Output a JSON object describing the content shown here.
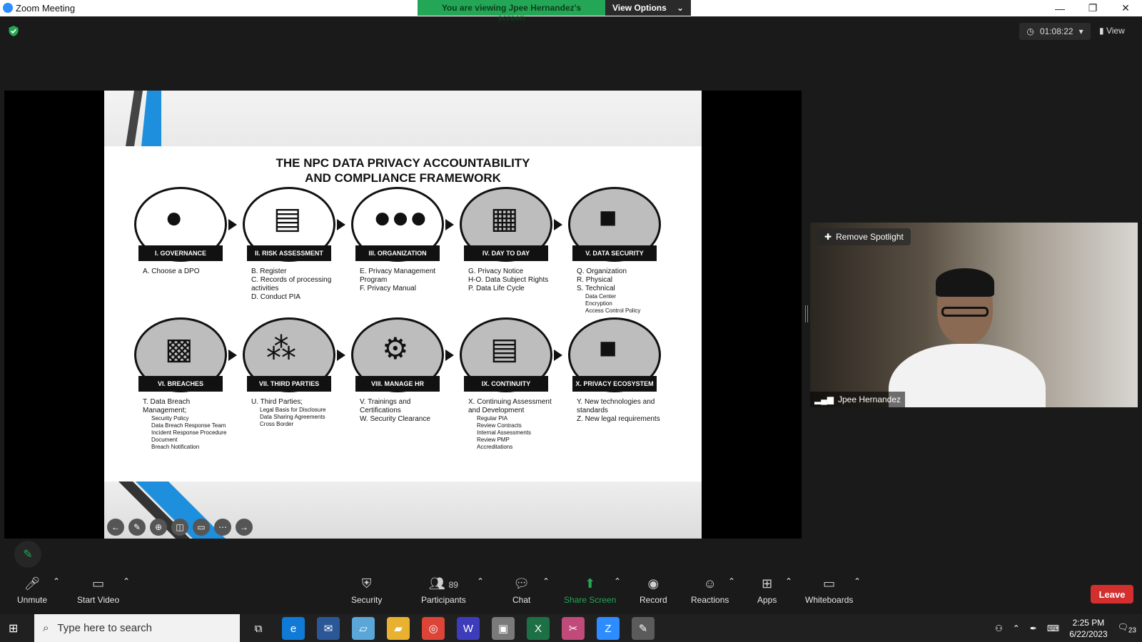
{
  "window": {
    "title": "Zoom Meeting",
    "minimize": "—",
    "restore": "❐",
    "close": "✕"
  },
  "banner": {
    "message": "You are viewing Jpee Hernandez's screen",
    "options_label": "View Options",
    "options_caret": "⌄"
  },
  "meeting": {
    "timer": "01:08:22",
    "timer_caret": "▾",
    "view_label": "View"
  },
  "slide": {
    "title_line1": "THE NPC DATA PRIVACY ACCOUNTABILITY",
    "title_line2": "AND COMPLIANCE FRAMEWORK",
    "stages": [
      {
        "banner": "I. GOVERNANCE",
        "items": [
          "A. Choose a DPO"
        ],
        "subitems": []
      },
      {
        "banner": "II. RISK ASSESSMENT",
        "items": [
          "B. Register",
          "C. Records of processing activities",
          "D. Conduct PIA"
        ],
        "subitems": []
      },
      {
        "banner": "III. ORGANIZATION",
        "items": [
          "E. Privacy Management Program",
          "F. Privacy Manual"
        ],
        "subitems": []
      },
      {
        "banner": "IV. DAY TO DAY",
        "items": [
          "G. Privacy Notice",
          "H-O. Data Subject Rights",
          "P. Data Life Cycle"
        ],
        "subitems": []
      },
      {
        "banner": "V. DATA SECURITY",
        "items": [
          "Q. Organization",
          "R. Physical",
          "S. Technical"
        ],
        "subitems": [
          "Data Center",
          "Encryption",
          "Access Control Policy"
        ]
      },
      {
        "banner": "VI. BREACHES",
        "items": [
          "T. Data Breach Management;"
        ],
        "subitems": [
          "Security Policy",
          "Data Breach Response Team",
          "Incident Response Procedure",
          "Document",
          "Breach Notification"
        ]
      },
      {
        "banner": "VII. THIRD PARTIES",
        "items": [
          "U. Third Parties;"
        ],
        "subitems": [
          "Legal Basis for Disclosure",
          "Data Sharing Agreements",
          "Cross Border"
        ]
      },
      {
        "banner": "VIII. MANAGE HR",
        "items": [
          "V. Trainings and Certifications",
          "W. Security Clearance"
        ],
        "subitems": []
      },
      {
        "banner": "IX. CONTINUITY",
        "items": [
          "X. Continuing Assessment and Development"
        ],
        "subitems": [
          "Regular PIA",
          "Review Contracts",
          "Internal Assessments",
          "Review PMP",
          "Accreditations"
        ]
      },
      {
        "banner": "X. PRIVACY ECOSYSTEM",
        "items": [
          "Y. New technologies and standards",
          "Z. New legal requirements"
        ],
        "subitems": []
      }
    ]
  },
  "video": {
    "remove_spotlight": "Remove Spotlight",
    "participant_name": "Jpee Hernandez"
  },
  "toolbar": {
    "unmute": "Unmute",
    "start_video": "Start Video",
    "security": "Security",
    "participants": "Participants",
    "participant_count": "89",
    "chat": "Chat",
    "share_screen": "Share Screen",
    "record": "Record",
    "reactions": "Reactions",
    "apps": "Apps",
    "whiteboards": "Whiteboards",
    "leave": "Leave",
    "caret": "⌃"
  },
  "taskbar": {
    "search_placeholder": "Type here to search",
    "time": "2:25 PM",
    "date": "6/22/2023",
    "notifications": "23"
  },
  "colors": {
    "zoom_green": "#23a756",
    "leave_red": "#d32f2f",
    "zoom_blue": "#2d8cff"
  }
}
